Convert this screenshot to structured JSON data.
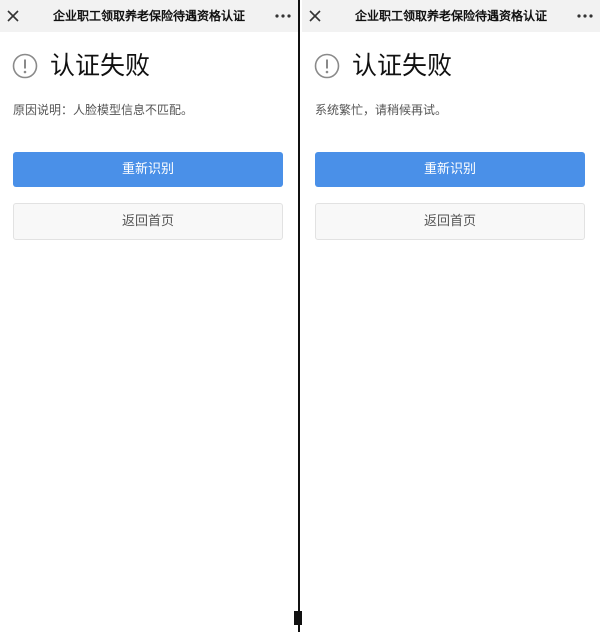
{
  "screens": [
    {
      "nav_title": "企业职工领取养老保险待遇资格认证",
      "result_title": "认证失败",
      "reason": "原因说明：人脸模型信息不匹配。",
      "retry_label": "重新识别",
      "home_label": "返回首页"
    },
    {
      "nav_title": "企业职工领取养老保险待遇资格认证",
      "result_title": "认证失败",
      "reason": "系统繁忙，请稍候再试。",
      "retry_label": "重新识别",
      "home_label": "返回首页"
    }
  ],
  "icons": {
    "close": "close-icon",
    "more": "more-icon",
    "warning": "warning-circle-icon"
  },
  "colors": {
    "primary_button": "#4a90e8",
    "nav_bar": "#f2f2f2",
    "divider": "#111111"
  }
}
